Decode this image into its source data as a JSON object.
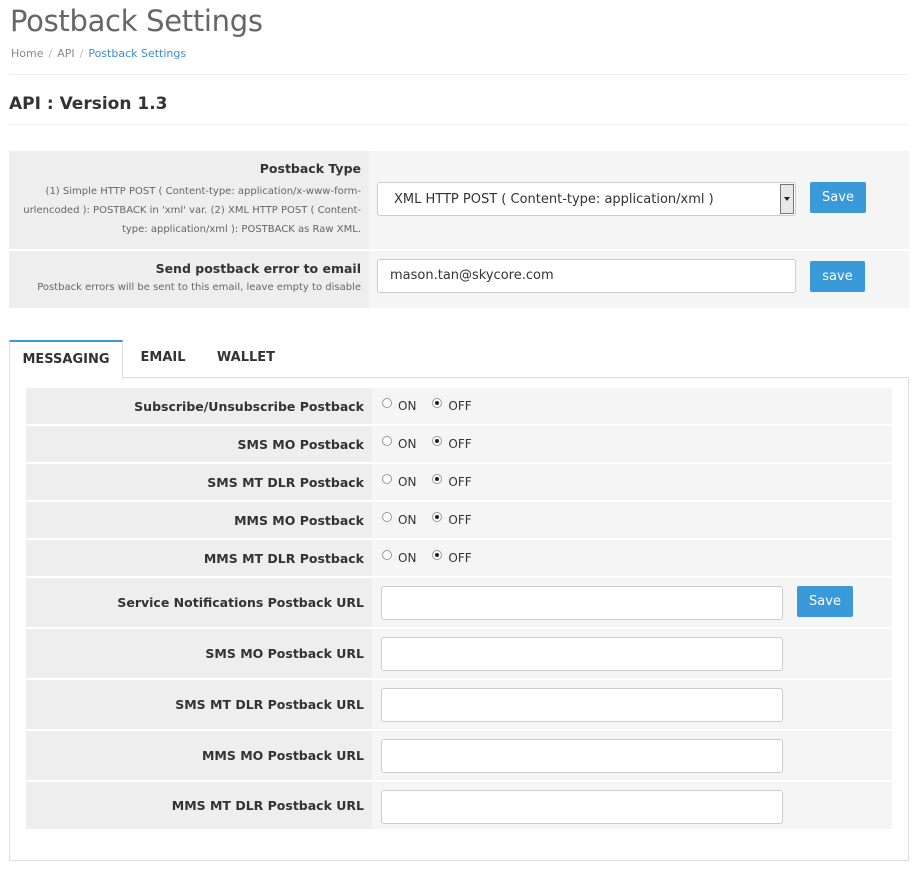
{
  "page": {
    "title": "Postback Settings",
    "version_heading": "API : Version 1.3"
  },
  "breadcrumb": {
    "items": [
      "Home",
      "API",
      "Postback Settings"
    ],
    "separator": "/"
  },
  "postback_type": {
    "title": "Postback Type",
    "help": "(1) Simple HTTP POST ( Content-type: application/x-www-form-urlencoded ): POSTBACK in 'xml' var. (2) XML HTTP POST ( Content-type: application/xml ): POSTBACK as Raw XML.",
    "selected": "XML HTTP POST ( Content-type: application/xml )",
    "save_label": "Save"
  },
  "error_email": {
    "title": "Send postback error to email",
    "help": "Postback errors will be sent to this email, leave empty to disable",
    "value": "mason.tan@skycore.com",
    "save_label": "save"
  },
  "tabs": [
    "MESSAGING",
    "EMAIL",
    "WALLET"
  ],
  "messaging": {
    "radio_on_label": "ON",
    "radio_off_label": "OFF",
    "toggles": [
      {
        "label": "Subscribe/Unsubscribe Postback",
        "value": "OFF"
      },
      {
        "label": "SMS MO Postback",
        "value": "OFF"
      },
      {
        "label": "SMS MT DLR Postback",
        "value": "OFF"
      },
      {
        "label": "MMS MO Postback",
        "value": "OFF"
      },
      {
        "label": "MMS MT DLR Postback",
        "value": "OFF"
      }
    ],
    "urls": [
      {
        "label": "Service Notifications Postback URL",
        "value": ""
      },
      {
        "label": "SMS MO Postback URL",
        "value": ""
      },
      {
        "label": "SMS MT DLR Postback URL",
        "value": ""
      },
      {
        "label": "MMS MO Postback URL",
        "value": ""
      },
      {
        "label": "MMS MT DLR Postback URL",
        "value": ""
      }
    ],
    "save_label": "Save"
  },
  "colors": {
    "accent": "#3a99d8",
    "breadcrumb_active": "#3a8fd4",
    "label_bg": "#eeeeee",
    "field_bg": "#f5f5f5"
  },
  "icons": {
    "select_arrow": "caret-down-icon",
    "radio": "radio-button-icon"
  }
}
